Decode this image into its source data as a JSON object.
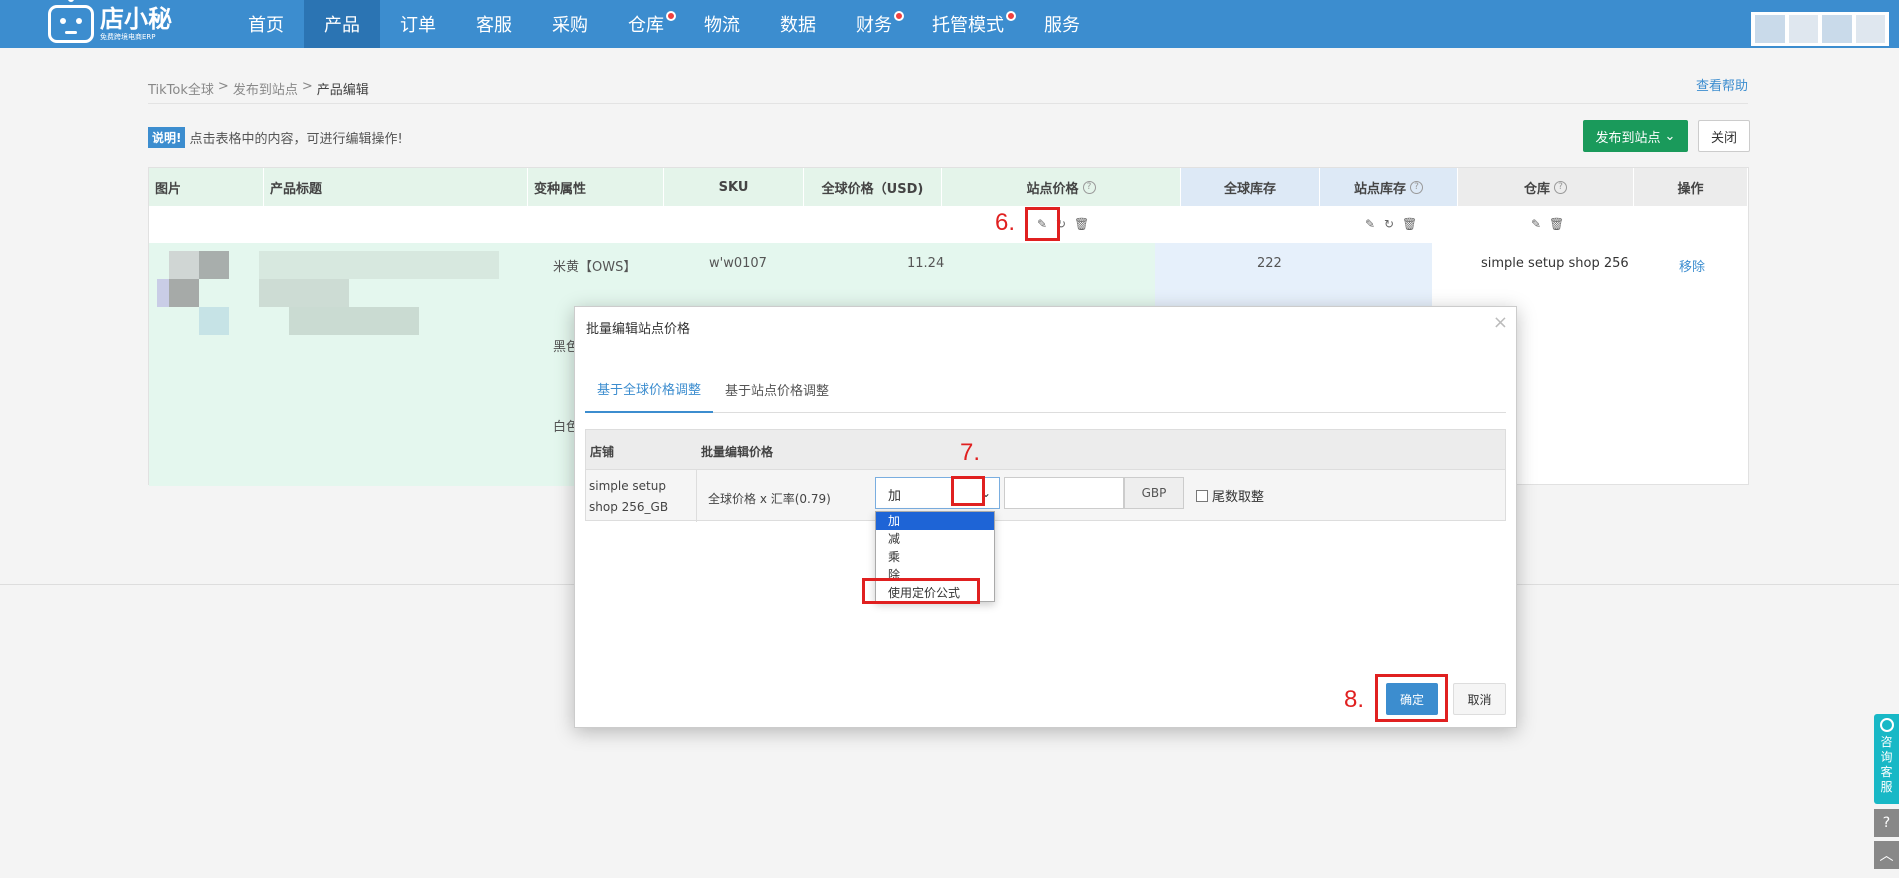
{
  "brand": {
    "name": "店小秘",
    "sub": "免费跨境电商ERP"
  },
  "nav": [
    {
      "label": "首页",
      "active": false,
      "dot": false
    },
    {
      "label": "产品",
      "active": true,
      "dot": false
    },
    {
      "label": "订单",
      "active": false,
      "dot": false
    },
    {
      "label": "客服",
      "active": false,
      "dot": false
    },
    {
      "label": "采购",
      "active": false,
      "dot": false
    },
    {
      "label": "仓库",
      "active": false,
      "dot": true
    },
    {
      "label": "物流",
      "active": false,
      "dot": false
    },
    {
      "label": "数据",
      "active": false,
      "dot": false
    },
    {
      "label": "财务",
      "active": false,
      "dot": true
    },
    {
      "label": "托管模式",
      "active": false,
      "dot": true
    },
    {
      "label": "服务",
      "active": false,
      "dot": false
    }
  ],
  "breadcrumb": {
    "items": [
      "TikTok全球",
      "发布到站点"
    ],
    "current": "产品编辑",
    "sep": ">"
  },
  "help_link": "查看帮助",
  "notice": {
    "badge": "说明!",
    "text": "点击表格中的内容，可进行编辑操作!"
  },
  "actions": {
    "publish": "发布到站点",
    "close": "关闭"
  },
  "table": {
    "headers": [
      "图片",
      "产品标题",
      "变种属性",
      "SKU",
      "全球价格（USD)",
      "站点价格",
      "全球库存",
      "站点库存",
      "仓库",
      "操作"
    ],
    "variants": [
      "米黄【OWS】",
      "黑色",
      "白色"
    ],
    "sku": "w'w0107",
    "global_price": "11.24",
    "global_stock": "222",
    "warehouse": "simple setup shop 256",
    "remove": "移除"
  },
  "dialog": {
    "title": "批量编辑站点价格",
    "close": "×",
    "tabs": [
      "基于全球价格调整",
      "基于站点价格调整"
    ],
    "col_shop": "店铺",
    "col_edit": "批量编辑价格",
    "shop_name": "simple setup shop 256_GB",
    "formula": "全球价格 x 汇率(0.79)",
    "operator_selected": "加",
    "unit": "GBP",
    "round_label": "尾数取整",
    "options": [
      "加",
      "减",
      "乘",
      "除",
      "使用定价公式"
    ],
    "ok": "确定",
    "cancel": "取消"
  },
  "annotations": {
    "step6": "6.",
    "step7": "7.",
    "step8": "8."
  },
  "consult": [
    "咨",
    "询",
    "客",
    "服"
  ],
  "colors": {
    "nav": "#3c8dcf",
    "nav_active": "#2b74b3",
    "publish": "#1a9a5b",
    "highlight_red": "#e02020",
    "row_green": "#e4f7ee",
    "row_blue": "#e6f0fb",
    "dropdown_selected": "#1e64d6"
  }
}
